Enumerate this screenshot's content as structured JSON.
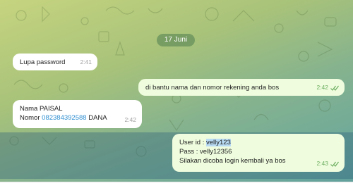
{
  "date_separator": "17 Juni",
  "messages": [
    {
      "text": "Lupa password",
      "time": "2:41"
    },
    {
      "text": "di bantu nama dan nomor rekening anda bos",
      "time": "2:42"
    },
    {
      "line1": "Nama PAISAL",
      "line2_prefix": "Nomor ",
      "phone": "082384392588",
      "line2_suffix": " DANA",
      "time": "2:42"
    },
    {
      "userid_label": "User id : ",
      "userid_value": "velly123",
      "pass_line": "Pass : velly12356",
      "line3": "Silakan dicoba login kembali ya bos",
      "time": "2:43"
    }
  ],
  "colors": {
    "incoming_bubble": "#ffffff",
    "outgoing_bubble": "#effdde",
    "link": "#2f8fd1",
    "read_ticks": "#6cad5f"
  },
  "icons": [
    "double-check-icon",
    "doodle-pattern"
  ]
}
